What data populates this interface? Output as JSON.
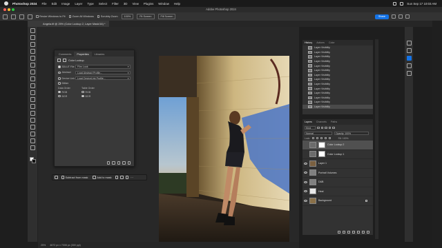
{
  "menubar": {
    "app_name": "Photoshop 2024",
    "items": [
      "File",
      "Edit",
      "Image",
      "Layer",
      "Type",
      "Select",
      "Filter",
      "3D",
      "View",
      "Plugins",
      "Window",
      "Help"
    ],
    "clock": "Sun Sep 17  10:03 AM"
  },
  "window": {
    "title": "Adobe Photoshop 2024"
  },
  "options": {
    "resize_windows": "Resize Windows to Fit",
    "zoom_all": "Zoom All Windows",
    "scrubby_zoom": "Scrubby Zoom",
    "zoom_pct": "100%",
    "fit_screen": "Fit Screen",
    "fill_screen": "Fill Screen",
    "share": "Share"
  },
  "document": {
    "tab": "Angela.tif @ 25% (Color Lookup 2, Layer Mask/16) *"
  },
  "properties": {
    "tabs": [
      "Comments",
      "Properties",
      "Libraries"
    ],
    "header": "Color Lookup",
    "rows": [
      {
        "label": "3DLUT File",
        "value": "Film Look"
      },
      {
        "label": "Abstract",
        "value": "Load Abstract Profile..."
      },
      {
        "label": "Device Link",
        "value": "Load DeviceLink Profile..."
      }
    ],
    "dither": "Dither",
    "data_order": "Data Order",
    "table_order": "Table Order",
    "rgb": "RGB",
    "bgr": "BGR"
  },
  "taskbar": {
    "subtract": "Subtract from mask",
    "add": "Add to mask"
  },
  "history": {
    "tabs": [
      "History",
      "Actions",
      "Color"
    ],
    "items": [
      "Layer Visibility",
      "Layer Visibility",
      "Layer Visibility",
      "Layer Visibility",
      "Layer Visibility",
      "Layer Visibility",
      "Layer Visibility",
      "Layer Visibility",
      "Layer Visibility",
      "Layer Visibility",
      "Layer Visibility",
      "Layer Visibility",
      "Layer Visibility",
      "Layer Visibility"
    ]
  },
  "layers": {
    "tabs": [
      "Layers",
      "Channels",
      "Paths"
    ],
    "kind": "Kind",
    "blend": "Normal",
    "opacity": "Opacity: 100%",
    "lock": "Lock:",
    "fill": "Fill: 100%",
    "items": [
      {
        "name": "Color Lookup 2",
        "selected": true,
        "mask": true
      },
      {
        "name": "Color Lookup 1",
        "selected": false,
        "mask": true
      },
      {
        "name": "Layer 1",
        "selected": false,
        "mask": false
      },
      {
        "name": "Portrait Volumes",
        "selected": false,
        "mask": false
      },
      {
        "name": "D&B",
        "selected": false,
        "mask": false
      },
      {
        "name": "Heal",
        "selected": false,
        "mask": false
      },
      {
        "name": "Background",
        "selected": false,
        "mask": false
      }
    ]
  },
  "status": {
    "zoom": "25%",
    "size": "4672 px x 7008 px (300 ppi)"
  },
  "colors": {
    "accent": "#1473e6",
    "panel": "#323232",
    "selected": "#505050"
  }
}
